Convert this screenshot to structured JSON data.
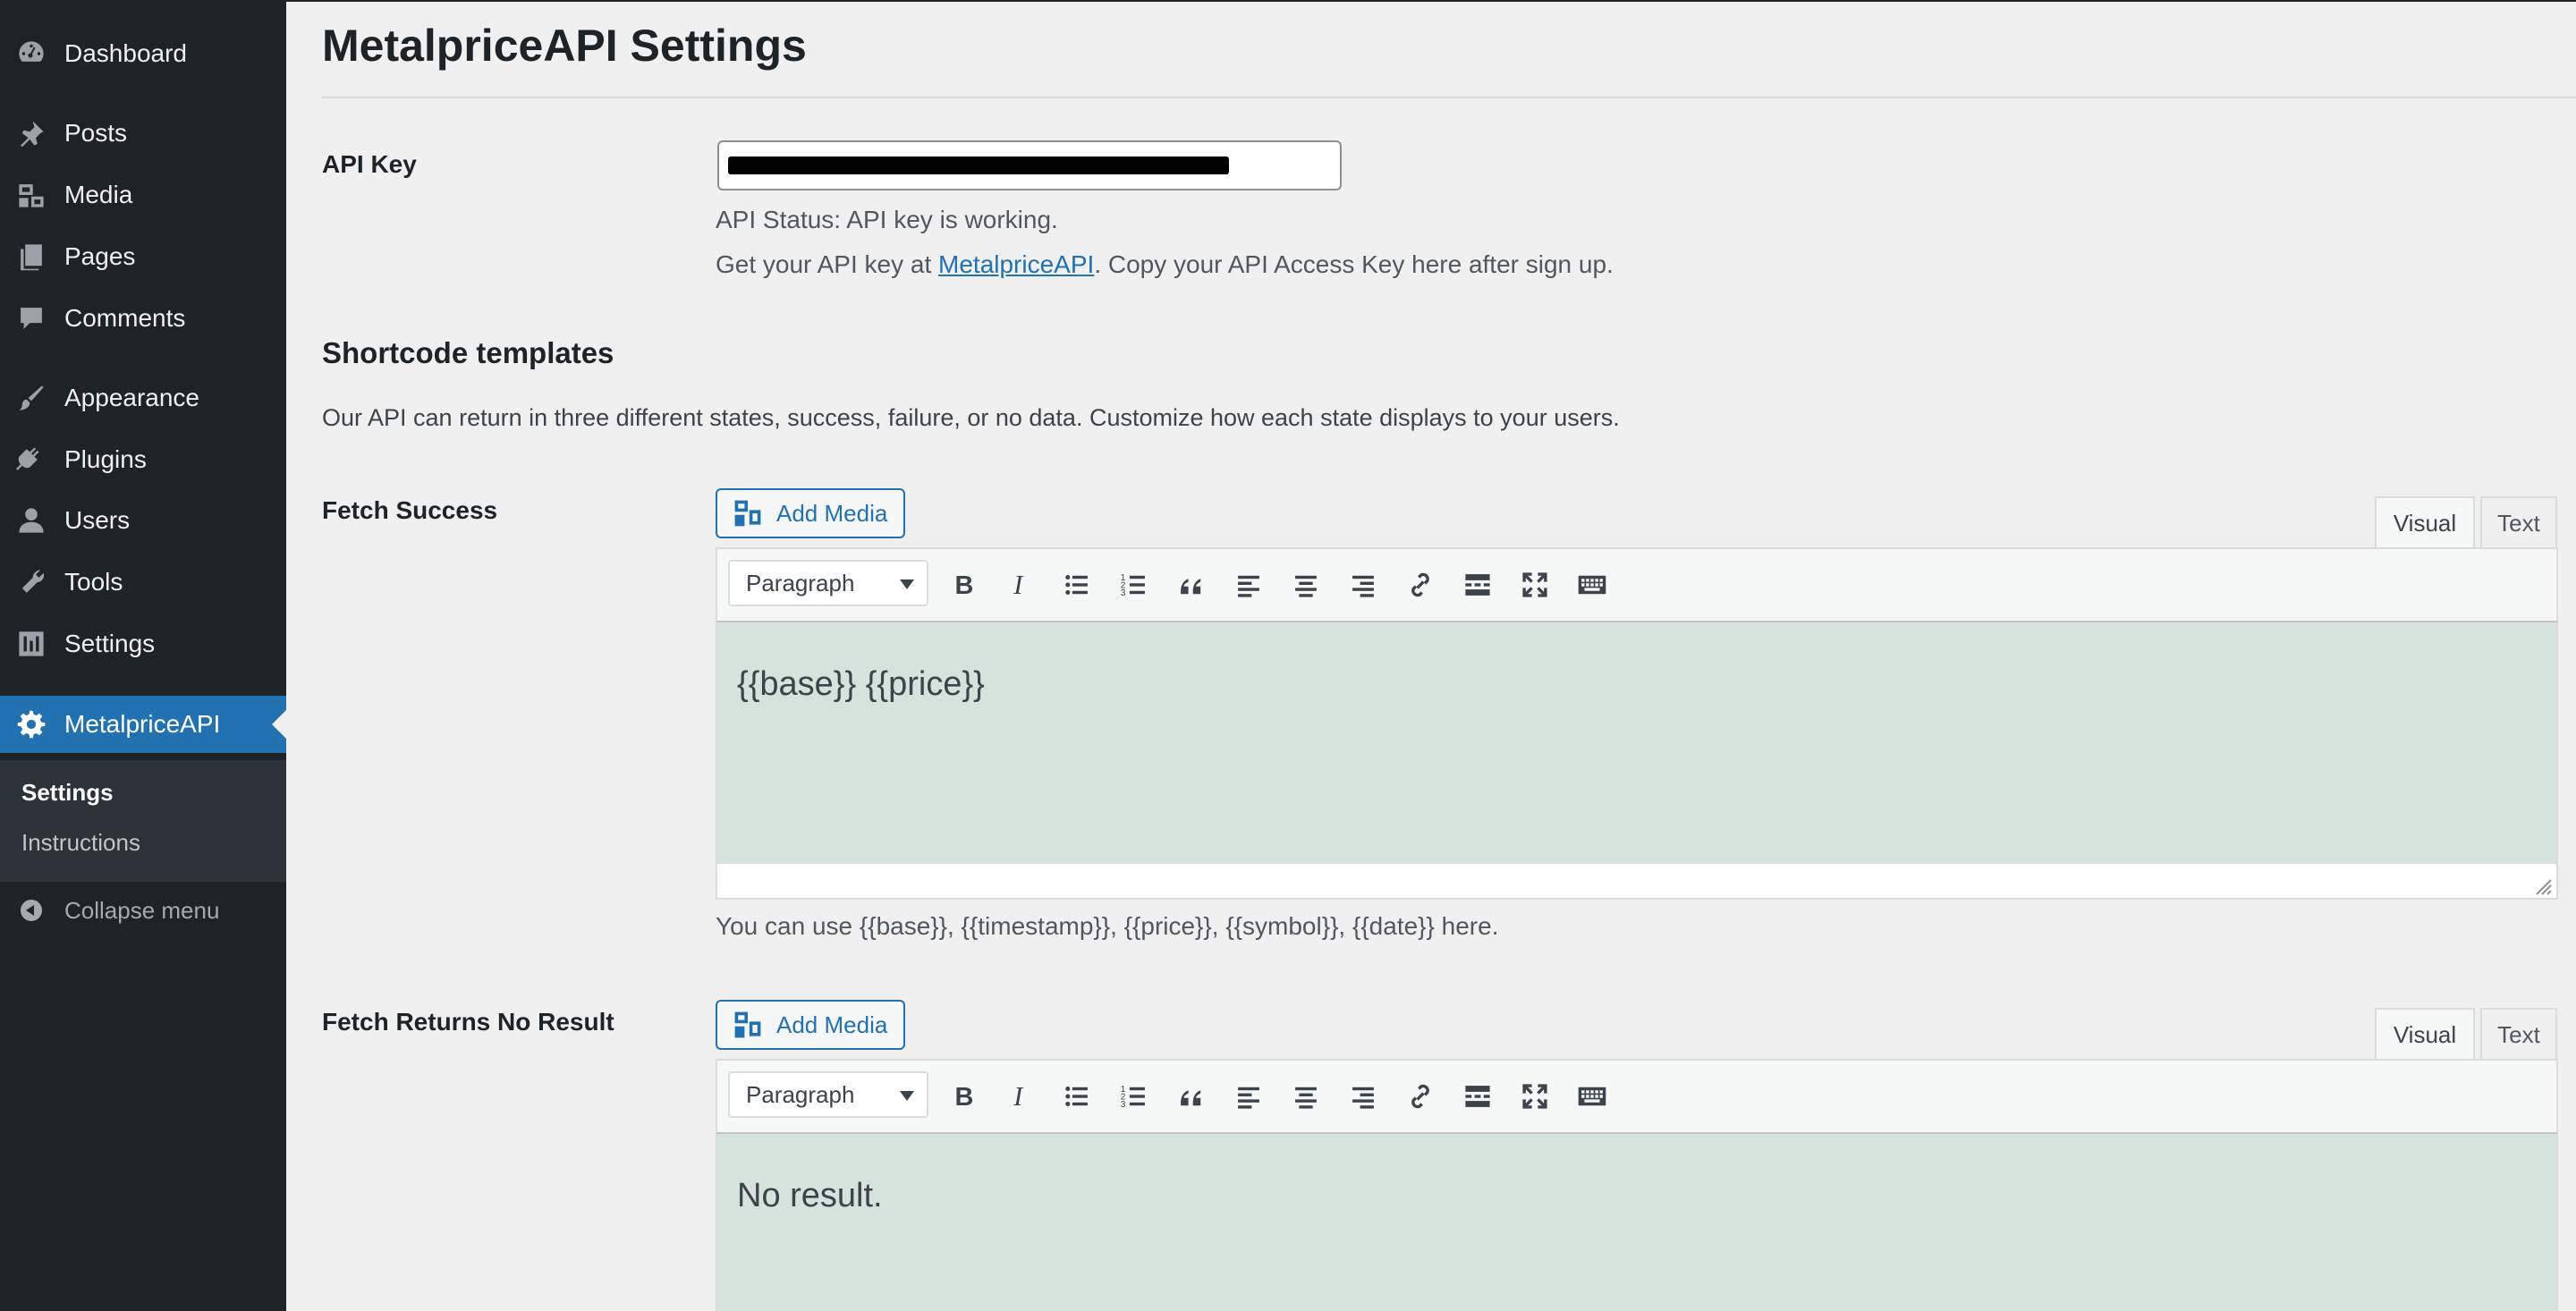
{
  "sidebar": {
    "items": [
      {
        "label": "Dashboard",
        "icon": "dashboard-icon"
      },
      {
        "label": "Posts",
        "icon": "pin-icon"
      },
      {
        "label": "Media",
        "icon": "media-icon"
      },
      {
        "label": "Pages",
        "icon": "pages-icon"
      },
      {
        "label": "Comments",
        "icon": "comment-icon"
      },
      {
        "label": "Appearance",
        "icon": "brush-icon"
      },
      {
        "label": "Plugins",
        "icon": "plug-icon"
      },
      {
        "label": "Users",
        "icon": "user-icon"
      },
      {
        "label": "Tools",
        "icon": "wrench-icon"
      },
      {
        "label": "Settings",
        "icon": "sliders-icon"
      },
      {
        "label": "MetalpriceAPI",
        "icon": "gear-icon"
      }
    ],
    "submenu": [
      {
        "label": "Settings"
      },
      {
        "label": "Instructions"
      }
    ],
    "collapse_label": "Collapse menu"
  },
  "page": {
    "title": "MetalpriceAPI Settings"
  },
  "api_key": {
    "label": "API Key",
    "status": "API Status: API key is working.",
    "help_prefix": "Get your API key at ",
    "help_link": "MetalpriceAPI",
    "help_suffix": ". Copy your API Access Key here after sign up."
  },
  "shortcode": {
    "title": "Shortcode templates",
    "description": "Our API can return in three different states, success, failure, or no data. Customize how each state displays to your users."
  },
  "editors": [
    {
      "label": "Fetch Success",
      "add_media": "Add Media",
      "tab_visual": "Visual",
      "tab_text": "Text",
      "format": "Paragraph",
      "content": "{{base}} {{price}}",
      "help": "You can use {{base}}, {{timestamp}}, {{price}}, {{symbol}}, {{date}} here."
    },
    {
      "label": "Fetch Returns No Result",
      "add_media": "Add Media",
      "tab_visual": "Visual",
      "tab_text": "Text",
      "format": "Paragraph",
      "content": "No result."
    }
  ],
  "toolbar_buttons": [
    "bold-icon",
    "italic-icon",
    "bullet-list-icon",
    "numbered-list-icon",
    "blockquote-icon",
    "align-left-icon",
    "align-center-icon",
    "align-right-icon",
    "link-icon",
    "read-more-icon",
    "fullscreen-icon",
    "toolbar-toggle-icon"
  ],
  "colors": {
    "sidebar_bg": "#1d2327",
    "accent": "#2271b1",
    "editor_bg": "#d5e3dc",
    "page_bg": "#f0f0f1"
  }
}
